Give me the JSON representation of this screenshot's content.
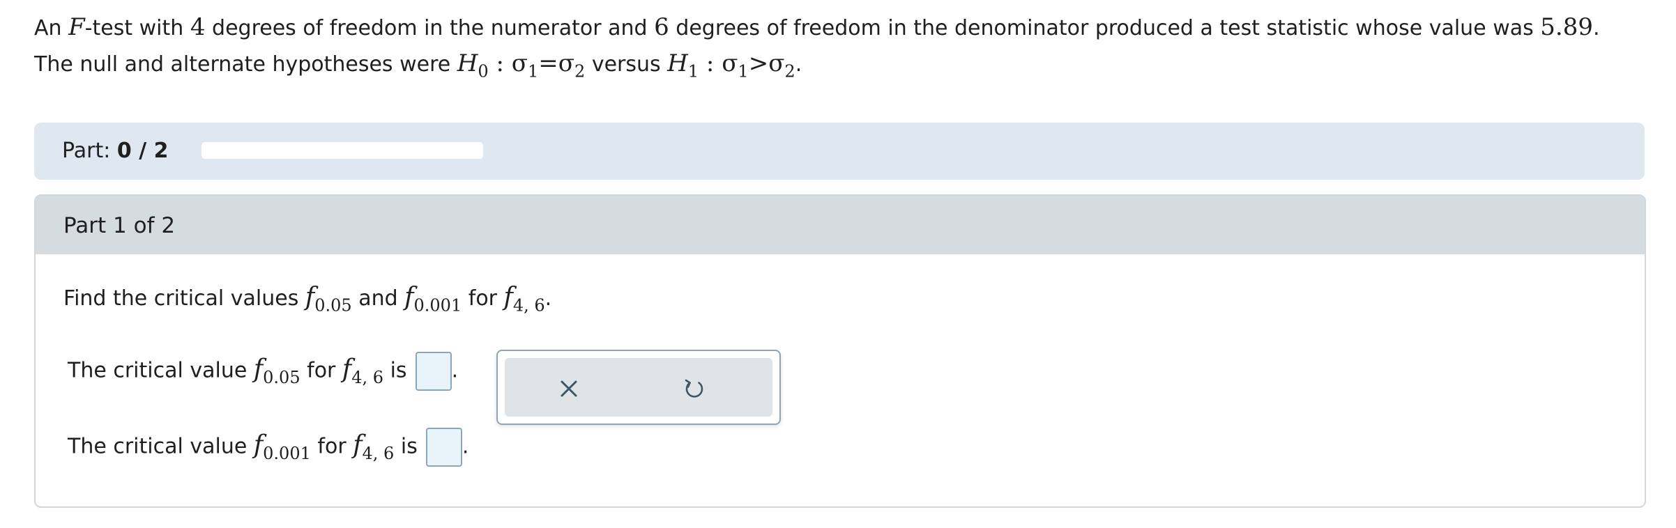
{
  "problem": {
    "t1": "An ",
    "F": "F",
    "t2": "-test with ",
    "df1": "4",
    "t3": " degrees of freedom in the numerator and ",
    "df2": "6",
    "t4": " degrees of freedom in the denominator produced a test statistic whose value was ",
    "stat": "5.89",
    "t5": ". The null and alternate hypotheses were ",
    "H": "H",
    "h0sub": "0",
    "colon": " : ",
    "sigma": "σ",
    "s1": "1",
    "eq": "=",
    "s2": "2",
    "versus": " versus ",
    "h1sub": "1",
    "gt": ">",
    "period": "."
  },
  "partbar": {
    "prefix": "Part: ",
    "value": "0 / 2",
    "progress": 0,
    "fill_color": "#3d7bbf"
  },
  "card": {
    "title": "Part 1 of 2",
    "instruction": {
      "t1": "Find the critical values ",
      "f": "f",
      "a1": "0.05",
      "and": " and ",
      "a2": "0.001",
      "for": " for ",
      "df": "4, 6",
      "period": "."
    },
    "q1": {
      "t1": "The critical value ",
      "sub": "0.05",
      "for": " for ",
      "df": "4, 6",
      "is": " is",
      "period": ".",
      "value": ""
    },
    "q2": {
      "t1": "The critical value ",
      "sub": "0.001",
      "for": " for ",
      "df": "4, 6",
      "is": " is",
      "period": ".",
      "value": ""
    }
  },
  "toolbox": {
    "clear_icon": "close-icon",
    "undo_icon": "undo-icon"
  }
}
